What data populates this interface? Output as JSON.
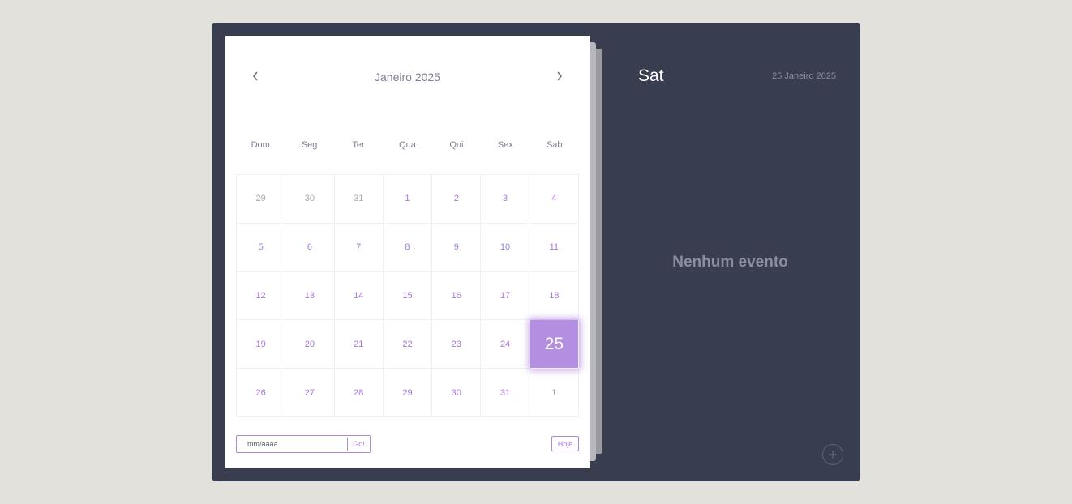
{
  "calendar": {
    "month_title": "Janeiro 2025",
    "weekdays": [
      "Dom",
      "Seg",
      "Ter",
      "Qua",
      "Qui",
      "Sex",
      "Sab"
    ],
    "days": [
      {
        "label": "29",
        "muted": true
      },
      {
        "label": "30",
        "muted": true
      },
      {
        "label": "31",
        "muted": true
      },
      {
        "label": "1"
      },
      {
        "label": "2"
      },
      {
        "label": "3"
      },
      {
        "label": "4"
      },
      {
        "label": "5"
      },
      {
        "label": "6"
      },
      {
        "label": "7"
      },
      {
        "label": "8"
      },
      {
        "label": "9"
      },
      {
        "label": "10"
      },
      {
        "label": "11"
      },
      {
        "label": "12"
      },
      {
        "label": "13"
      },
      {
        "label": "14"
      },
      {
        "label": "15"
      },
      {
        "label": "16"
      },
      {
        "label": "17"
      },
      {
        "label": "18"
      },
      {
        "label": "19"
      },
      {
        "label": "20"
      },
      {
        "label": "21"
      },
      {
        "label": "22"
      },
      {
        "label": "23"
      },
      {
        "label": "24"
      },
      {
        "label": "25",
        "selected": true
      },
      {
        "label": "26"
      },
      {
        "label": "27"
      },
      {
        "label": "28"
      },
      {
        "label": "29"
      },
      {
        "label": "30"
      },
      {
        "label": "31"
      },
      {
        "label": "1",
        "muted": true
      }
    ],
    "goto": {
      "placeholder": "mm/aaaa",
      "value": "",
      "button_label": "Go!"
    },
    "today_label": "Hoje"
  },
  "events_panel": {
    "day_name": "Sat",
    "full_date": "25 Janeiro 2025",
    "empty_message": "Nenhum evento"
  },
  "icons": {
    "prev": "chevron-left-icon",
    "next": "chevron-right-icon",
    "add": "plus-icon"
  },
  "colors": {
    "accent": "#b48ee0",
    "day_text": "#a77ad8",
    "panel_background": "#393d50",
    "page_background": "#e3e1dc"
  }
}
